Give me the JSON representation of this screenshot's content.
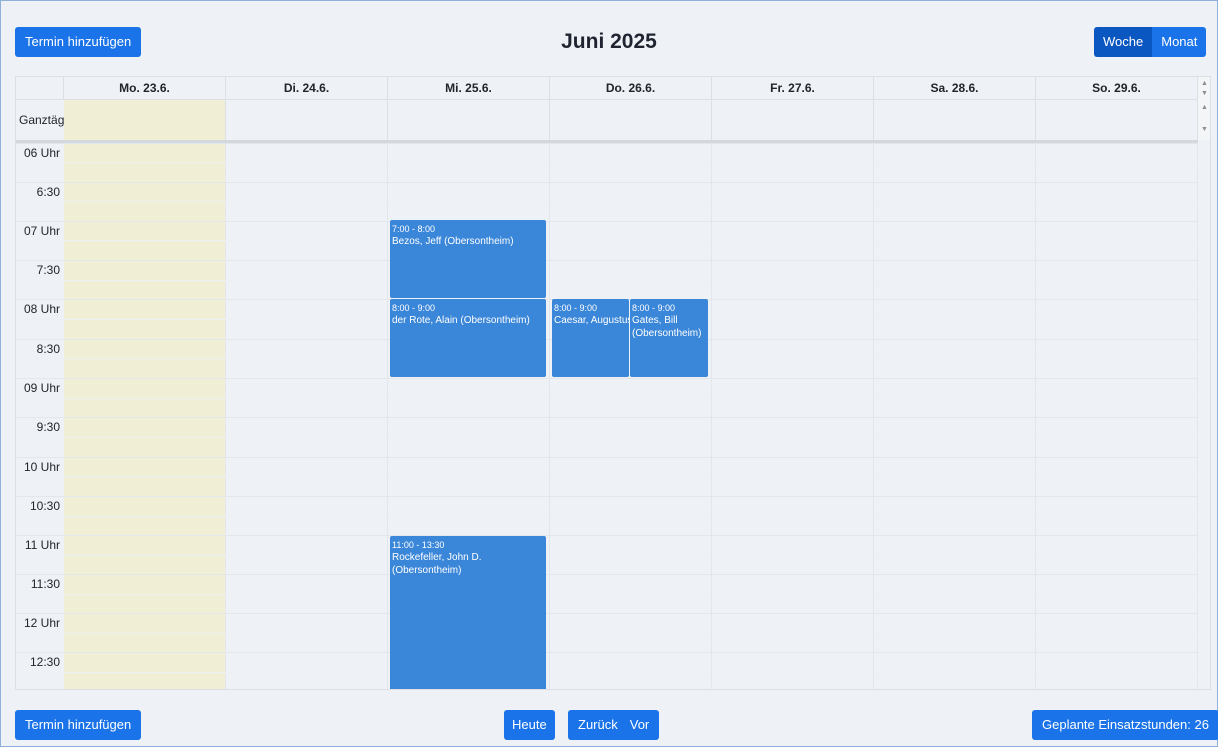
{
  "header": {
    "add_event_label": "Termin hinzufügen",
    "title": "Juni 2025",
    "view_week_label": "Woche",
    "view_month_label": "Monat"
  },
  "calendar": {
    "allday_label": "Ganztägig",
    "days": [
      "Mo. 23.6.",
      "Di. 24.6.",
      "Mi. 25.6.",
      "Do. 26.6.",
      "Fr. 27.6.",
      "Sa. 28.6.",
      "So. 29.6."
    ],
    "time_labels": [
      "06 Uhr",
      "6:30",
      "07 Uhr",
      "7:30",
      "08 Uhr",
      "8:30",
      "09 Uhr",
      "9:30",
      "10 Uhr",
      "10:30",
      "11 Uhr",
      "11:30",
      "12 Uhr",
      "12:30"
    ],
    "events": [
      {
        "time": "7:00 - 8:00",
        "name": "Bezos, Jeff (Obersontheim)"
      },
      {
        "time": "8:00 - 9:00",
        "name": "der Rote, Alain (Obersontheim)"
      },
      {
        "time": "8:00 - 9:00",
        "name": "Caesar, Augustus (Obersontheim)"
      },
      {
        "time": "8:00 - 9:00",
        "name": "Gates, Bill (Obersontheim)"
      },
      {
        "time": "11:00 - 13:30",
        "name": "Rockefeller, John D. (Obersontheim)"
      }
    ]
  },
  "footer": {
    "add_event_label": "Termin hinzufügen",
    "today_label": "Heute",
    "back_label": "Zurück",
    "forward_label": "Vor",
    "planned_hours_label": "Geplante Einsatzstunden: 26"
  },
  "colors": {
    "accent": "#1a73e8",
    "accent_active": "#0a57c2",
    "event": "#3a86d8",
    "today_bg": "#f1eed6"
  }
}
